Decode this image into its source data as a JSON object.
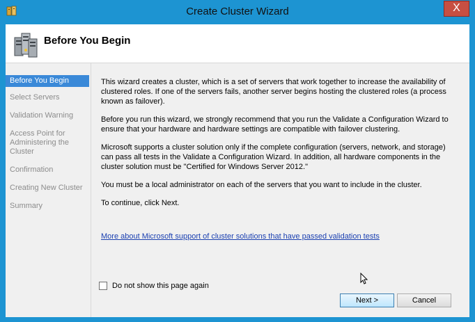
{
  "window": {
    "title": "Create Cluster Wizard",
    "close_glyph": "X"
  },
  "header": {
    "title": "Before You Begin"
  },
  "nav": {
    "items": [
      {
        "label": "Before You Begin",
        "active": true
      },
      {
        "label": "Select Servers",
        "active": false
      },
      {
        "label": "Validation Warning",
        "active": false
      },
      {
        "label": "Access Point for Administering the Cluster",
        "active": false
      },
      {
        "label": "Confirmation",
        "active": false
      },
      {
        "label": "Creating New Cluster",
        "active": false
      },
      {
        "label": "Summary",
        "active": false
      }
    ]
  },
  "main": {
    "paragraphs": [
      "This wizard creates a cluster, which is a set of servers that work together to increase the availability of clustered roles. If one of the servers fails, another server begins hosting the clustered roles (a process known as failover).",
      "Before you run this wizard, we strongly recommend that you run the Validate a Configuration Wizard to ensure that your hardware and hardware settings are compatible with failover clustering.",
      "Microsoft supports a cluster solution only if the complete configuration (servers, network, and storage) can pass all tests in the Validate a Configuration Wizard. In addition, all hardware components in the cluster solution must be \"Certified for Windows Server 2012.\"",
      "You must be a local administrator on each of the servers that you want to include in the cluster.",
      "To continue, click Next."
    ],
    "link": "More about Microsoft support of cluster solutions that have passed validation tests"
  },
  "checkbox": {
    "label": "Do not show this page again",
    "checked": false
  },
  "buttons": {
    "next": "Next >",
    "cancel": "Cancel"
  },
  "colors": {
    "frame": "#1d94d2",
    "nav_active": "#3a89d8",
    "link": "#1a3fb0",
    "close": "#c74f42"
  }
}
